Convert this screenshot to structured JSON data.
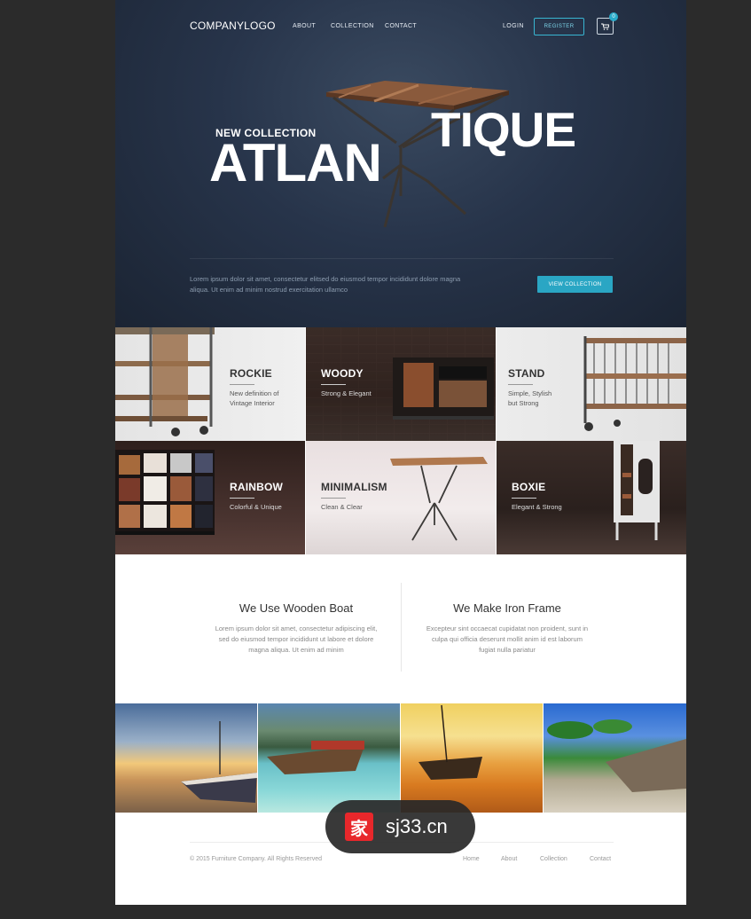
{
  "nav": {
    "logo": "COMPANYLOGO",
    "links": [
      "ABOUT",
      "COLLECTION",
      "CONTACT"
    ],
    "login": "LOGIN",
    "register": "REGISTER",
    "cart_count": "0"
  },
  "hero": {
    "kicker": "NEW COLLECTION",
    "title_left": "ATLAN",
    "title_right": "TIQUE",
    "text": "Lorem ipsum dolor sit amet, consectetur elitsed do eiusmod tempor incididunt dolore magna aliqua. Ut enim ad minim nostrud exercitation ullamco",
    "cta": "VIEW COLLECTION"
  },
  "tiles": [
    {
      "title": "ROCKIE",
      "sub": "New definition of Vintage Interior"
    },
    {
      "title": "WOODY",
      "sub": "Strong & Elegant"
    },
    {
      "title": "STAND",
      "sub": "Simple, Stylish but Strong"
    },
    {
      "title": "RAINBOW",
      "sub": "Colorful & Unique"
    },
    {
      "title": "MINIMALISM",
      "sub": "Clean & Clear"
    },
    {
      "title": "BOXIE",
      "sub": "Elegant & Strong"
    }
  ],
  "features": [
    {
      "title": "We Use Wooden Boat",
      "text": "Lorem ipsum dolor sit amet, consectetur adipiscing elit, sed do eiusmod tempor incididunt ut labore et dolore magna aliqua. Ut enim ad minim"
    },
    {
      "title": "We Make Iron Frame",
      "text": "Excepteur sint occaecat cupidatat non proident, sunt in culpa qui officia deserunt mollit anim id est laborum  fugiat nulla pariatur"
    }
  ],
  "footer": {
    "copyright": "© 2015 Furniture Company. All Rights Reserved",
    "links": [
      "Home",
      "About",
      "Collection",
      "Contact"
    ]
  },
  "watermark": {
    "icon": "家",
    "text": "sj33.cn"
  },
  "colors": {
    "accent": "#2aa6c4",
    "hero_bg": "#27344a"
  }
}
